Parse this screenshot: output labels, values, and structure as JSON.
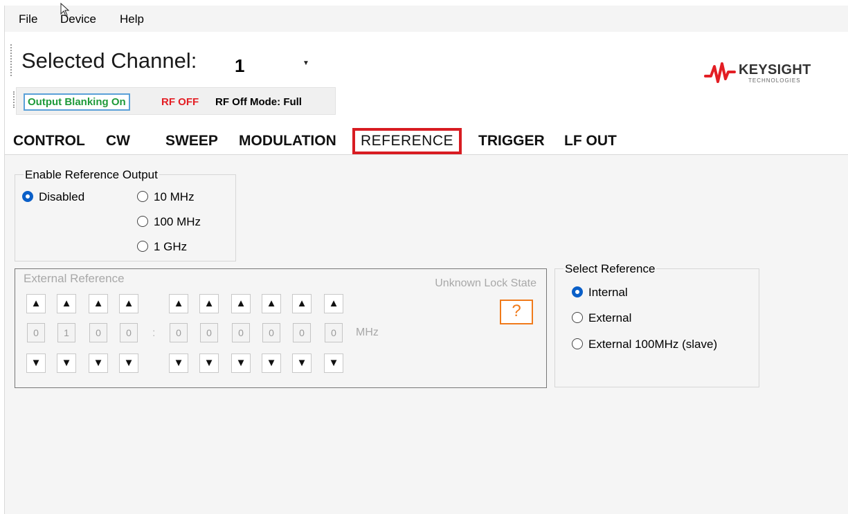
{
  "menu": {
    "file": "File",
    "device": "Device",
    "help": "Help"
  },
  "channel": {
    "label": "Selected Channel:",
    "value": "1"
  },
  "status": {
    "blanking": "Output Blanking On",
    "rf": "RF OFF",
    "mode": "RF Off Mode: Full"
  },
  "logo": {
    "name": "KEYSIGHT",
    "sub": "TECHNOLOGIES"
  },
  "tabs": {
    "control": "CONTROL",
    "cw": "CW",
    "sweep": "SWEEP",
    "modulation": "MODULATION",
    "reference": "REFERENCE",
    "trigger": "TRIGGER",
    "lfout": "LF OUT",
    "active": "REFERENCE"
  },
  "enable_ref_output": {
    "title": "Enable Reference Output",
    "options": [
      "Disabled",
      "10 MHz",
      "100 MHz",
      "1 GHz"
    ],
    "selected": "Disabled"
  },
  "external_reference": {
    "title": "External Reference",
    "lock_state": "Unknown Lock State",
    "lock_icon": "?",
    "integer_digits": [
      "0",
      "1",
      "0",
      "0"
    ],
    "separator": ":",
    "fraction_digits": [
      "0",
      "0",
      "0",
      "0",
      "0",
      "0"
    ],
    "unit": "MHz"
  },
  "select_reference": {
    "title": "Select Reference",
    "options": [
      "Internal",
      "External",
      "External 100MHz (slave)"
    ],
    "selected": "Internal"
  },
  "colors": {
    "accent": "#0a5fc8",
    "tab_highlight": "#d81c22",
    "blanking_text": "#1e9a3a",
    "rf_off": "#e31e24",
    "lock_icon": "#f07a1a",
    "logo_red": "#e31e24"
  }
}
